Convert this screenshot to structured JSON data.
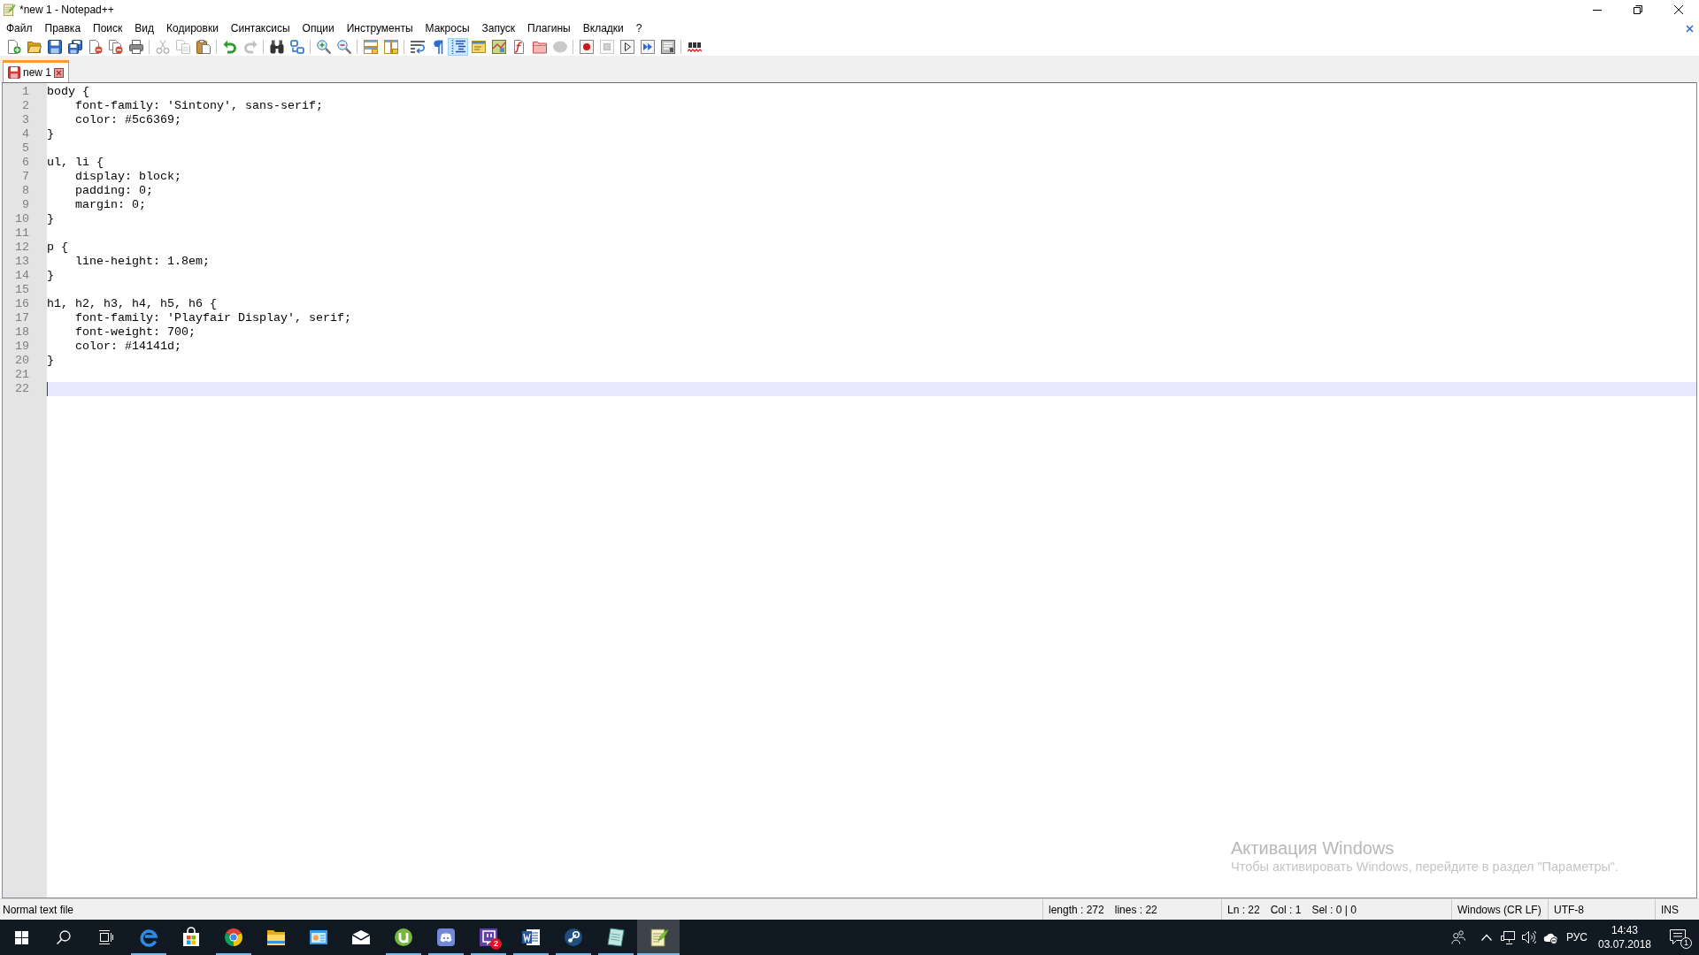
{
  "window": {
    "title": "*new 1 - Notepad++"
  },
  "menu": [
    "Файл",
    "Правка",
    "Поиск",
    "Вид",
    "Кодировки",
    "Синтаксисы",
    "Опции",
    "Инструменты",
    "Макросы",
    "Запуск",
    "Плагины",
    "Вкладки",
    "?"
  ],
  "toolbar": [
    [
      {
        "pressed": false,
        "disabled": false
      },
      {
        "pressed": false,
        "disabled": false
      },
      {
        "pressed": false,
        "disabled": false
      },
      {
        "pressed": false,
        "disabled": false
      },
      {
        "pressed": false,
        "disabled": false
      },
      {
        "pressed": false,
        "disabled": false
      },
      {
        "pressed": false,
        "disabled": false
      }
    ],
    [
      {
        "pressed": false,
        "disabled": true
      },
      {
        "pressed": false,
        "disabled": true
      },
      {
        "pressed": false,
        "disabled": false
      }
    ],
    [
      {
        "pressed": false,
        "disabled": false
      },
      {
        "pressed": false,
        "disabled": true
      }
    ],
    [
      {
        "pressed": false,
        "disabled": false
      },
      {
        "pressed": false,
        "disabled": false
      }
    ],
    [
      {
        "pressed": false,
        "disabled": false
      },
      {
        "pressed": false,
        "disabled": false
      }
    ],
    [
      {
        "pressed": false,
        "disabled": false
      },
      {
        "pressed": false,
        "disabled": false
      }
    ],
    [
      {
        "pressed": false,
        "disabled": false
      },
      {
        "pressed": false,
        "disabled": false
      },
      {
        "pressed": true,
        "disabled": false
      },
      {
        "pressed": false,
        "disabled": false
      },
      {
        "pressed": false,
        "disabled": false
      },
      {
        "pressed": false,
        "disabled": false
      },
      {
        "pressed": false,
        "disabled": false
      },
      {
        "pressed": false,
        "disabled": true
      }
    ],
    [
      {
        "pressed": false,
        "disabled": false
      },
      {
        "pressed": false,
        "disabled": true
      },
      {
        "pressed": false,
        "disabled": false
      },
      {
        "pressed": false,
        "disabled": false
      },
      {
        "pressed": false,
        "disabled": false
      }
    ],
    [
      {
        "pressed": false,
        "disabled": false
      }
    ]
  ],
  "tabs": [
    {
      "label": "new 1",
      "selected": true,
      "modified": true
    }
  ],
  "editor": {
    "lines": [
      {
        "number": "1",
        "text": "body {",
        "current": false
      },
      {
        "number": "2",
        "text": "    font-family: 'Sintony', sans-serif;",
        "current": false
      },
      {
        "number": "3",
        "text": "    color: #5c6369;",
        "current": false
      },
      {
        "number": "4",
        "text": "}",
        "current": false
      },
      {
        "number": "5",
        "current": false
      },
      {
        "number": "6",
        "text": "ul, li {",
        "current": false
      },
      {
        "number": "7",
        "text": "    display: block;",
        "current": false
      },
      {
        "number": "8",
        "text": "    padding: 0;",
        "current": false
      },
      {
        "number": "9",
        "text": "    margin: 0;",
        "current": false
      },
      {
        "number": "10",
        "text": "}",
        "current": false
      },
      {
        "number": "11",
        "current": false
      },
      {
        "number": "12",
        "text": "p {",
        "current": false
      },
      {
        "number": "13",
        "text": "    line-height: 1.8em;",
        "current": false
      },
      {
        "number": "14",
        "text": "}",
        "current": false
      },
      {
        "number": "15",
        "current": false
      },
      {
        "number": "16",
        "text": "h1, h2, h3, h4, h5, h6 {",
        "current": false
      },
      {
        "number": "17",
        "text": "    font-family: 'Playfair Display', serif;",
        "current": false
      },
      {
        "number": "18",
        "text": "    font-weight: 700;",
        "current": false
      },
      {
        "number": "19",
        "text": "    color: #14141d;",
        "current": false
      },
      {
        "number": "20",
        "text": "}",
        "current": false
      },
      {
        "number": "21",
        "current": false
      },
      {
        "number": "22",
        "current": true
      }
    ]
  },
  "status_bar": {
    "file_type": "Normal text file",
    "document": [
      "length : 272",
      "lines : 22"
    ],
    "position": [
      "Ln : 22",
      "Col : 1",
      "Sel : 0 | 0"
    ],
    "eol": "Windows (CR LF)",
    "encoding": "UTF-8",
    "mode": "INS"
  },
  "activation_notice": {
    "title": "Активация Windows",
    "text": "Чтобы активировать Windows, перейдите в раздел \"Параметры\"."
  },
  "taskbar": {
    "apps": [
      {
        "running": true,
        "selected": false
      },
      {
        "running": false,
        "selected": false
      },
      {
        "running": true,
        "selected": false
      },
      {
        "running": false,
        "selected": false
      },
      {
        "running": false,
        "selected": false
      },
      {
        "running": false,
        "selected": false
      },
      {
        "running": true,
        "selected": false
      },
      {
        "running": true,
        "selected": false
      },
      {
        "running": true,
        "selected": false,
        "badge": "2"
      },
      {
        "running": true,
        "selected": false
      },
      {
        "running": true,
        "selected": false
      },
      {
        "running": true,
        "selected": false
      },
      {
        "running": true,
        "selected": true
      }
    ],
    "tray": {
      "language": "РУС",
      "time": "14:43",
      "date": "03.07.2018",
      "notification_count": "1"
    }
  }
}
